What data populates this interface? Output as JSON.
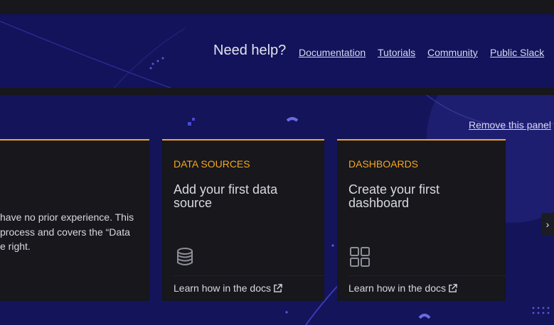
{
  "help": {
    "title": "Need help?",
    "links": [
      "Documentation",
      "Tutorials",
      "Community",
      "Public Slack"
    ]
  },
  "panel": {
    "remove_label": "Remove this panel",
    "intro_card": {
      "lines": [
        "have no prior experience. This",
        "process and covers the “Data",
        "e right."
      ]
    },
    "cards": [
      {
        "kicker": "DATA SOURCES",
        "heading": "Add your first data source",
        "icon": "database-icon",
        "learn": "Learn how in the docs"
      },
      {
        "kicker": "DASHBOARDS",
        "heading": "Create your first dashboard",
        "icon": "apps-grid-icon",
        "learn": "Learn how in the docs"
      }
    ],
    "next_icon": "chevron-right-icon"
  },
  "colors": {
    "accent": "#f5a623",
    "band": "#12135a",
    "card": "#17171c"
  }
}
